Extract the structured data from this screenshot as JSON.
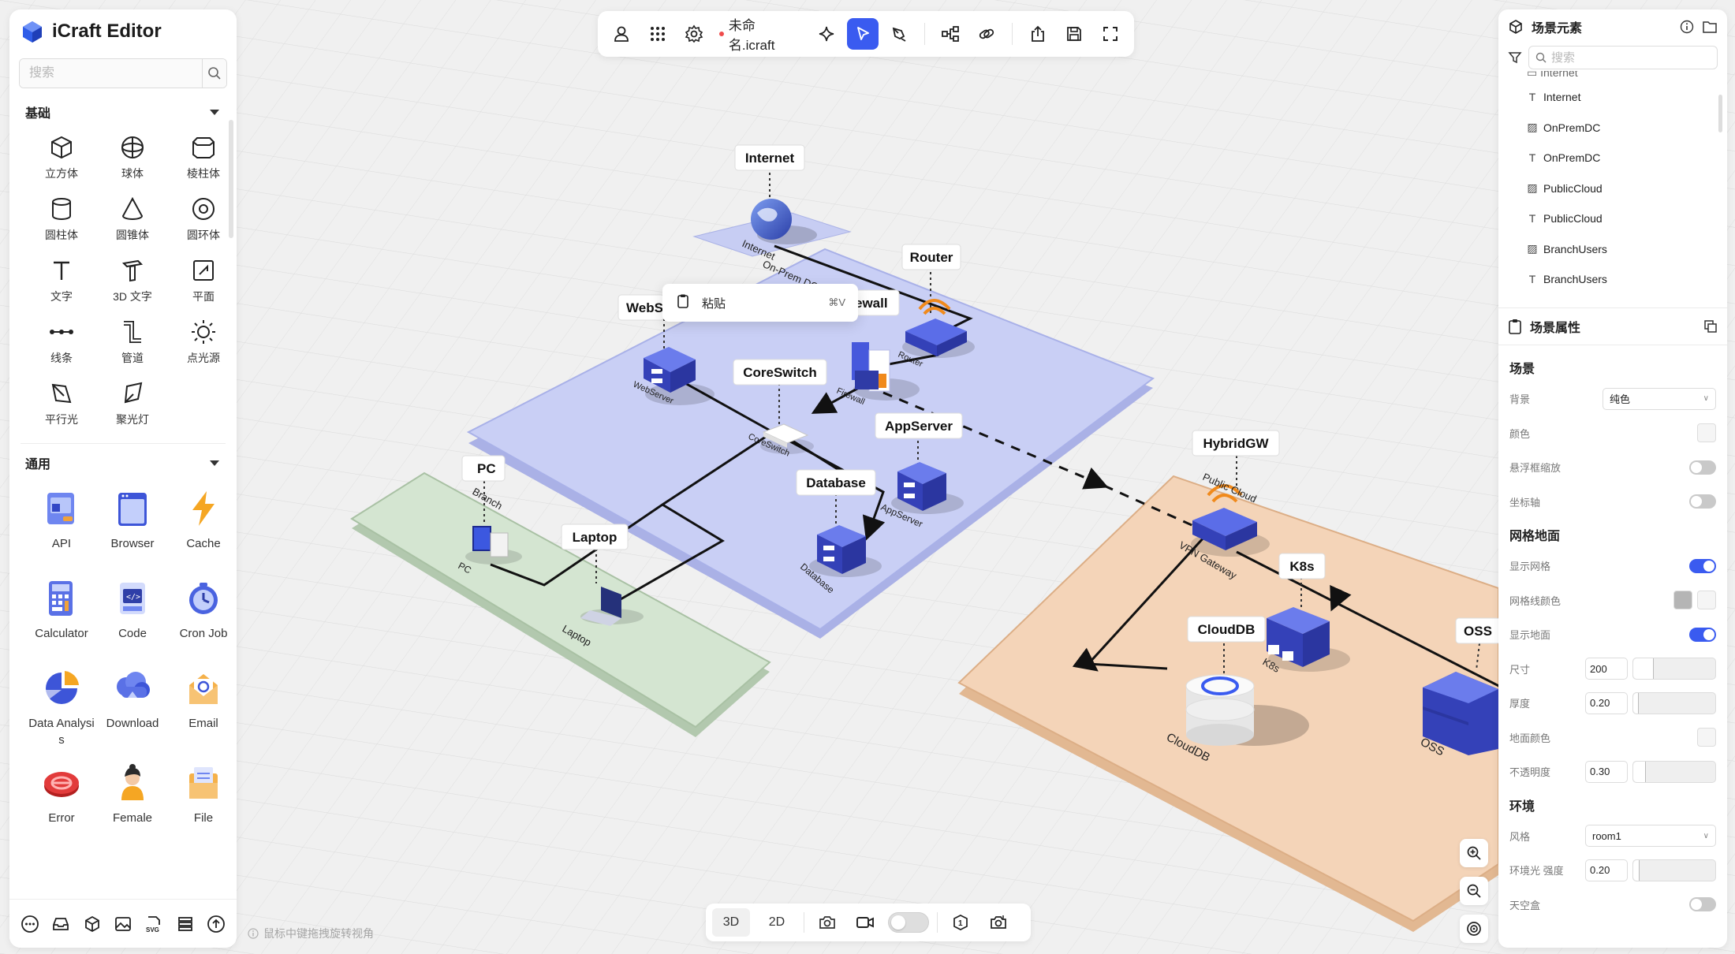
{
  "app": {
    "name": "iCraft Editor"
  },
  "left_panel": {
    "search_placeholder": "搜索",
    "basic_section": "基础",
    "basic_items": [
      {
        "label": "立方体",
        "icon": "cube-icon"
      },
      {
        "label": "球体",
        "icon": "sphere-icon"
      },
      {
        "label": "棱柱体",
        "icon": "prism-icon"
      },
      {
        "label": "圆柱体",
        "icon": "cylinder-icon"
      },
      {
        "label": "圆锥体",
        "icon": "cone-icon"
      },
      {
        "label": "圆环体",
        "icon": "torus-icon"
      },
      {
        "label": "文字",
        "icon": "text-icon"
      },
      {
        "label": "3D 文字",
        "icon": "text-3d-icon"
      },
      {
        "label": "平面",
        "icon": "plane-icon"
      },
      {
        "label": "线条",
        "icon": "line-icon"
      },
      {
        "label": "管道",
        "icon": "pipe-icon"
      },
      {
        "label": "点光源",
        "icon": "point-light-icon"
      },
      {
        "label": "平行光",
        "icon": "directional-light-icon"
      },
      {
        "label": "聚光灯",
        "icon": "spotlight-icon"
      }
    ],
    "common_section": "通用",
    "common_items": [
      {
        "label": "API",
        "icon": "api-icon"
      },
      {
        "label": "Browser",
        "icon": "browser-icon"
      },
      {
        "label": "Cache",
        "icon": "cache-icon"
      },
      {
        "label": "Calculator",
        "icon": "calculator-icon"
      },
      {
        "label": "Code",
        "icon": "code-icon"
      },
      {
        "label": "Cron Job",
        "icon": "cron-job-icon"
      },
      {
        "label": "Data Analysis",
        "icon": "data-analysis-icon"
      },
      {
        "label": "Download",
        "icon": "download-icon"
      },
      {
        "label": "Email",
        "icon": "email-icon"
      },
      {
        "label": "Error",
        "icon": "error-icon"
      },
      {
        "label": "Female",
        "icon": "female-icon"
      },
      {
        "label": "File",
        "icon": "file-icon"
      }
    ],
    "hint": "鼠标中键拖拽旋转视角"
  },
  "toolbar": {
    "file_name": "未命名.icraft",
    "modified": true
  },
  "context_menu": {
    "label": "粘贴",
    "shortcut": "⌘V"
  },
  "right_panel": {
    "elements_title": "场景元素",
    "search_placeholder": "搜索",
    "tree_cut_label": "Internet",
    "tree": [
      {
        "type": "T",
        "label": "Internet"
      },
      {
        "type": "plane",
        "label": "OnPremDC"
      },
      {
        "type": "T",
        "label": "OnPremDC"
      },
      {
        "type": "plane",
        "label": "PublicCloud"
      },
      {
        "type": "T",
        "label": "PublicCloud"
      },
      {
        "type": "plane",
        "label": "BranchUsers"
      },
      {
        "type": "T",
        "label": "BranchUsers"
      }
    ],
    "props_title": "场景属性",
    "scene": {
      "title": "场景",
      "background_label": "背景",
      "background_value": "纯色",
      "color_label": "颜色",
      "hover_zoom_label": "悬浮框缩放",
      "hover_zoom": false,
      "axis_label": "坐标轴",
      "axis": false
    },
    "grid": {
      "title": "网格地面",
      "show_grid_label": "显示网格",
      "show_grid": true,
      "grid_color_label": "网格线颜色",
      "show_ground_label": "显示地面",
      "show_ground": true,
      "size_label": "尺寸",
      "size_value": "200",
      "size_level": 0.25,
      "thickness_label": "厚度",
      "thickness_value": "0.20",
      "thickness_level": 0.07,
      "ground_color_label": "地面颜色",
      "opacity_label": "不透明度",
      "opacity_value": "0.30",
      "opacity_level": 0.15
    },
    "env": {
      "title": "环境",
      "style_label": "风格",
      "style_value": "room1",
      "ambient_label": "环境光 强度",
      "ambient_value": "0.20",
      "ambient_level": 0.08,
      "skybox_label": "天空盒",
      "skybox": false
    }
  },
  "bottom_toolbar": {
    "tab_3d": "3D",
    "tab_2d": "2D"
  },
  "scene_labels": {
    "internet": "Internet",
    "router": "Router",
    "webserver_tag": "WebS",
    "firewall_tag": "ewall",
    "coreswitch": "CoreSwitch",
    "appserver": "AppServer",
    "database": "Database",
    "pc": "PC",
    "laptop": "Laptop",
    "hybridgw": "HybridGW",
    "k8s": "K8s",
    "clouddb": "CloudDB",
    "oss": "OSS"
  },
  "ground_labels": {
    "internet": "Internet",
    "onprem": "On-Prem DC",
    "branch": "Branch",
    "public_cloud": "Public Cloud",
    "router": "Router",
    "firewall": "Firewall",
    "webserver": "WebServer",
    "coreswitch": "CoreSwitch",
    "appserver": "AppServer",
    "database": "Database",
    "pc": "PC",
    "laptop": "Laptop",
    "vpn": "VPN Gateway",
    "k8s": "K8s",
    "clouddb": "CloudDB",
    "oss": "OSS"
  },
  "colors": {
    "accent": "#3a5bf0",
    "onprem_plate": "#c9cff5",
    "branch_plate": "#cfe1cc",
    "cloud_plate": "#f4d3b7",
    "device_blue": "#3f51d8"
  }
}
